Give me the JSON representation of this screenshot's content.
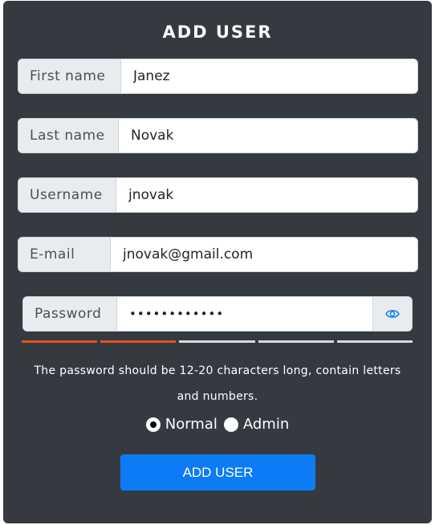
{
  "form": {
    "title": "ADD USER",
    "fields": [
      {
        "label": "First name",
        "value": "Janez"
      },
      {
        "label": "Last name",
        "value": "Novak"
      },
      {
        "label": "Username",
        "value": "jnovak"
      },
      {
        "label": "E-mail",
        "value": "jnovak@gmail.com"
      }
    ],
    "password": {
      "label": "Password",
      "value": "••••••••••••",
      "toggle_icon": "eye-icon"
    },
    "strength": {
      "filled_segments": 2,
      "total_segments": 5,
      "filled_color": "#e8501c",
      "empty_color": "#d9d9d9"
    },
    "hint": "The password should be 12-20 characters long, contain letters and numbers.",
    "roles": {
      "options": [
        "Normal",
        "Admin"
      ],
      "selected": "Normal"
    },
    "submit_label": "ADD USER"
  },
  "colors": {
    "panel_bg": "#343a40",
    "addon_bg": "#e9ecef",
    "primary": "#0d7bf5"
  }
}
